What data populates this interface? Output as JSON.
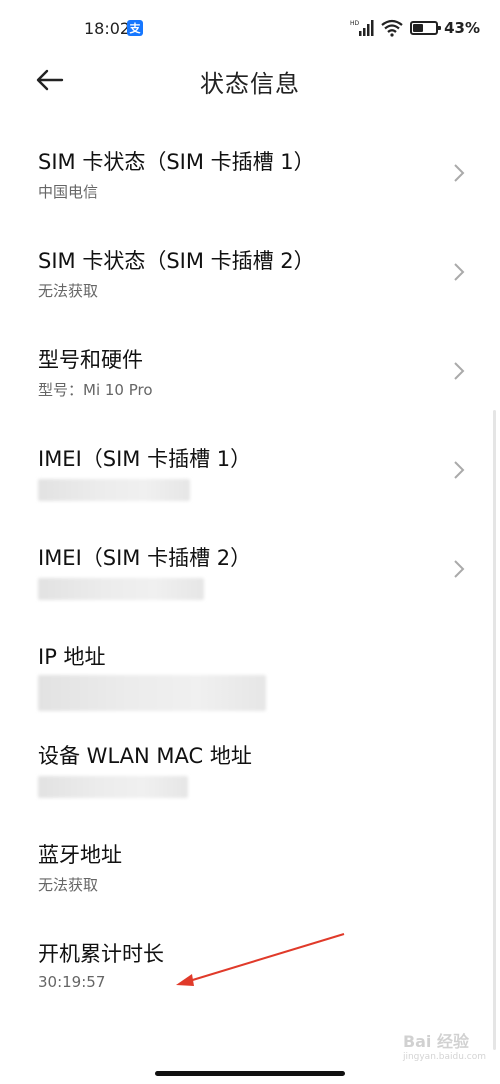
{
  "status_bar": {
    "time": "18:02",
    "app_icon": "alipay-icon",
    "app_icon_char": "支",
    "battery_percent": "43%",
    "battery_level": 0.43
  },
  "header": {
    "back_icon": "arrow-left-icon",
    "title": "状态信息"
  },
  "items": [
    {
      "title": "SIM 卡状态（SIM 卡插槽 1）",
      "subtitle": "中国电信",
      "chevron": true
    },
    {
      "title": "SIM 卡状态（SIM 卡插槽 2）",
      "subtitle": "无法获取",
      "chevron": true
    },
    {
      "title": "型号和硬件",
      "subtitle": "型号：Mi 10 Pro",
      "chevron": true
    },
    {
      "title": "IMEI（SIM 卡插槽 1）",
      "subtitle": "",
      "chevron": true
    },
    {
      "title": "IMEI（SIM 卡插槽 2）",
      "subtitle": "",
      "chevron": true
    },
    {
      "title": "IP 地址",
      "subtitle": "",
      "chevron": false
    },
    {
      "title": "设备 WLAN MAC 地址",
      "subtitle": "",
      "chevron": false
    },
    {
      "title": "蓝牙地址",
      "subtitle": "无法获取",
      "chevron": false
    },
    {
      "title": "开机累计时长",
      "subtitle": "30:19:57",
      "chevron": false
    }
  ],
  "watermark": {
    "main": "Bai 经验",
    "sub": "jingyan.baidu.com"
  },
  "colors": {
    "annotation_arrow": "#e03a2a",
    "alipay": "#1677ff"
  }
}
